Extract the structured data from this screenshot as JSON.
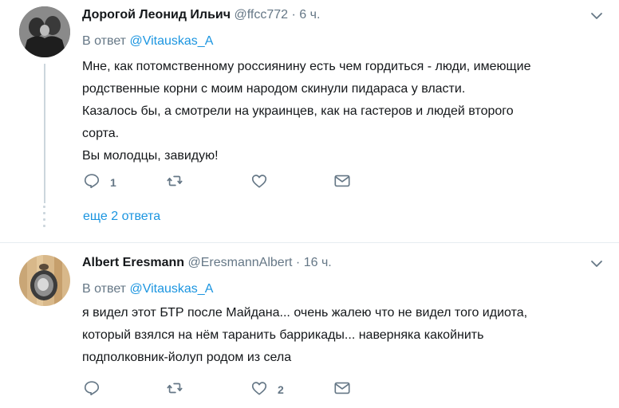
{
  "tweets": [
    {
      "name": "Дорогой Леонид Ильич",
      "handle": "@ffcc772",
      "separator": "·",
      "time": "6 ч.",
      "reply_prefix": "В ответ",
      "reply_mention": "@Vitauskas_A",
      "lines": [
        "Мне, как потомственному россиянину есть чем гордиться - люди, имеющие",
        "родственные корни с моим народом скинули пидараса у власти.",
        "Казалось бы, а смотрели на украинцев, как на гастеров и людей второго",
        "сорта.",
        "Вы молодцы, завидую!"
      ],
      "reply_count": "1",
      "retweet_count": "",
      "like_count": "",
      "more_replies": "еще 2 ответа"
    },
    {
      "name": "Albert Eresmann",
      "handle": "@EresmannAlbert",
      "separator": "·",
      "time": "16 ч.",
      "reply_prefix": "В ответ",
      "reply_mention": "@Vitauskas_A",
      "lines": [
        "я видел этот БТР после Майдана... очень жалею что не видел того идиота,",
        "который взялся на нём таранить баррикады... наверняка какойнить",
        "подполковник-йолуп родом из села"
      ],
      "reply_count": "",
      "retweet_count": "",
      "like_count": "2"
    }
  ],
  "icons": {
    "reply": "reply-icon",
    "retweet": "retweet-icon",
    "like": "heart-icon",
    "message": "envelope-icon",
    "menu": "chevron-down-icon"
  },
  "colors": {
    "link": "#1b95e0",
    "secondary": "#657786",
    "icon": "#657786",
    "divider": "#e6ecf0",
    "thread": "#ccd6dd"
  }
}
